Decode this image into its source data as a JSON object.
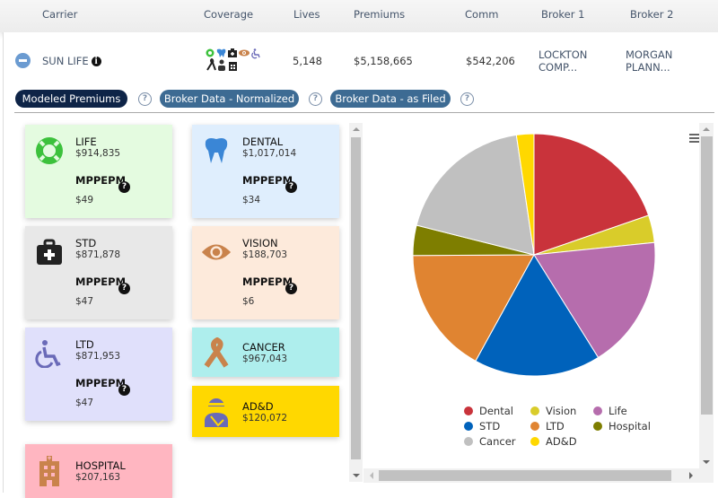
{
  "header": {
    "columns": [
      "Carrier",
      "Coverage",
      "Lives",
      "Premiums",
      "Comm",
      "Broker 1",
      "Broker 2"
    ]
  },
  "row": {
    "carrier": "SUN LIFE",
    "lives": "5,148",
    "premiums": "$5,158,665",
    "comm": "$542,206",
    "broker1_line1": "LOCKTON",
    "broker1_line2": "COMP...",
    "broker2_line1": "MORGAN",
    "broker2_line2": "PLANN...",
    "coverage_icons": [
      "life-ring-icon",
      "tooth-icon",
      "medkit-icon",
      "eye-icon",
      "wheelchair-icon",
      "ribbon-icon",
      "injured-person-icon",
      "hospital-icon"
    ]
  },
  "tabs": [
    {
      "label": "Modeled Premiums",
      "active": true
    },
    {
      "label": "Broker Data - Normalized",
      "active": false
    },
    {
      "label": "Broker Data - as Filed",
      "active": false
    }
  ],
  "help": "?",
  "tiles": [
    {
      "name": "LIFE",
      "amount": "$914,835",
      "metric": "MPPEPM",
      "per": "$49",
      "icon": "life-ring-icon",
      "bg": "#e4fbe0",
      "color": "#3cc13c"
    },
    {
      "name": "DENTAL",
      "amount": "$1,017,014",
      "metric": "MPPEPM",
      "per": "$34",
      "icon": "tooth-icon",
      "bg": "#dfeefd",
      "color": "#3a86d6"
    },
    {
      "name": "STD",
      "amount": "$871,878",
      "metric": "MPPEPM",
      "per": "$47",
      "icon": "medkit-icon",
      "bg": "#e8e8e8",
      "color": "#222222"
    },
    {
      "name": "VISION",
      "amount": "$188,703",
      "metric": "MPPEPM",
      "per": "$6",
      "icon": "eye-icon",
      "bg": "#fdeadb",
      "color": "#c9834c"
    },
    {
      "name": "LTD",
      "amount": "$871,953",
      "metric": "MPPEPM",
      "per": "$47",
      "icon": "wheelchair-icon",
      "bg": "#e0e0fb",
      "color": "#6a6ab8"
    },
    {
      "name": "CANCER",
      "amount": "$967,043",
      "icon": "ribbon-icon",
      "bg": "#aeeeed",
      "color": "#c9834c"
    },
    {
      "name": "AD&D",
      "amount": "$120,072",
      "icon": "injured-person-icon",
      "bg": "#ffd800",
      "color": "#6a6ab8"
    },
    {
      "name": "HOSPITAL",
      "amount": "$207,163",
      "icon": "hospital-icon",
      "bg": "#ffb6c1",
      "color": "#c9834c"
    }
  ],
  "chart_data": {
    "type": "pie",
    "title": "",
    "categories": [
      "Dental",
      "Vision",
      "Life",
      "STD",
      "LTD",
      "Hospital",
      "Cancer",
      "AD&D"
    ],
    "values": [
      1017014,
      188703,
      914835,
      871878,
      871953,
      207163,
      967043,
      120072
    ],
    "colors": [
      "#c9333b",
      "#d9cc2a",
      "#b66dad",
      "#0062bb",
      "#e08431",
      "#7e7e00",
      "#c0c0c0",
      "#ffd800"
    ],
    "legend_order": [
      "Dental",
      "Vision",
      "Life",
      "STD",
      "LTD",
      "Hospital",
      "Cancer",
      "AD&D"
    ],
    "legend_position": "bottom"
  }
}
